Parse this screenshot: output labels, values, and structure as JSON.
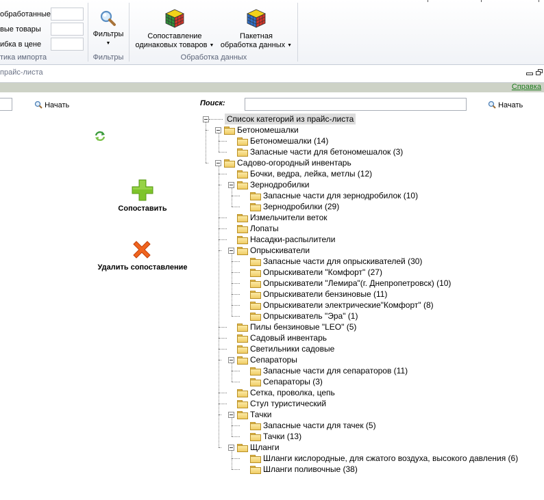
{
  "ribbon": {
    "import_group": {
      "rows": [
        "обработанные",
        "вые товары",
        "ибка в цене"
      ],
      "group_label": "тика импорта"
    },
    "filters_group": {
      "button_label": "Фильтры",
      "group_label": "Фильтры"
    },
    "processing_group": {
      "match_button": [
        "Сопоставление",
        "одинаковых товаров"
      ],
      "batch_button": [
        "Пакетная",
        "обработка данных"
      ],
      "group_label": "Обработка данных"
    }
  },
  "caption": {
    "title": "прайс-листа",
    "help_link": "Справка"
  },
  "left_search": {
    "start_label": "Начать"
  },
  "right_search": {
    "label": "Поиск:",
    "start_label": "Начать"
  },
  "actions": {
    "match_label": "Сопоставить",
    "delete_label": "Удалить сопоставление"
  },
  "colors": {
    "plus": "#7ec42a",
    "cross": "#f0641e",
    "help": "#1a7a1a",
    "green_bar": "#cdd2c6"
  },
  "tree": {
    "root": "Список категорий из прайс-листа",
    "nodes": [
      {
        "level": 1,
        "label": "Бетономешалки",
        "expanded": true,
        "last": false
      },
      {
        "level": 2,
        "label": "Бетономешалки (14)",
        "expanded": false,
        "last": false
      },
      {
        "level": 2,
        "label": "Запасные части для бетономешалок (3)",
        "expanded": false,
        "last": true
      },
      {
        "level": 1,
        "label": "Садово-огородный инвентарь",
        "expanded": true,
        "last": true
      },
      {
        "level": 2,
        "label": "Бочки, ведра, лейка, метлы (12)",
        "expanded": false,
        "last": false
      },
      {
        "level": 2,
        "label": "Зернодробилки",
        "expanded": true,
        "last": false
      },
      {
        "level": 3,
        "label": "Запасные части для зернодробилок (10)",
        "expanded": false,
        "last": false
      },
      {
        "level": 3,
        "label": "Зернодробилки (29)",
        "expanded": false,
        "last": true
      },
      {
        "level": 2,
        "label": "Измельчители веток",
        "expanded": false,
        "last": false
      },
      {
        "level": 2,
        "label": "Лопаты",
        "expanded": false,
        "last": false
      },
      {
        "level": 2,
        "label": "Насадки-распылители",
        "expanded": false,
        "last": false
      },
      {
        "level": 2,
        "label": "Опрыскиватели",
        "expanded": true,
        "last": false
      },
      {
        "level": 3,
        "label": "Запасные части для опрыскивателей (30)",
        "expanded": false,
        "last": false
      },
      {
        "level": 3,
        "label": "Опрыскиватели \"Комфорт\" (27)",
        "expanded": false,
        "last": false
      },
      {
        "level": 3,
        "label": "Опрыскиватели \"Лемира\"(г. Днепропетровск) (10)",
        "expanded": false,
        "last": false
      },
      {
        "level": 3,
        "label": "Опрыскиватели бензиновые (11)",
        "expanded": false,
        "last": false
      },
      {
        "level": 3,
        "label": "Опрыскиватели электрические\"Комфорт\" (8)",
        "expanded": false,
        "last": false
      },
      {
        "level": 3,
        "label": "Опрыскиватель \"Эра\" (1)",
        "expanded": false,
        "last": true
      },
      {
        "level": 2,
        "label": "Пилы бензиновые \"LEO\" (5)",
        "expanded": false,
        "last": false
      },
      {
        "level": 2,
        "label": "Садовый инвентарь",
        "expanded": false,
        "last": false
      },
      {
        "level": 2,
        "label": "Светильники садовые",
        "expanded": false,
        "last": false
      },
      {
        "level": 2,
        "label": "Сепараторы",
        "expanded": true,
        "last": false
      },
      {
        "level": 3,
        "label": "Запасные части для сепараторов (11)",
        "expanded": false,
        "last": false
      },
      {
        "level": 3,
        "label": "Сепараторы (3)",
        "expanded": false,
        "last": true
      },
      {
        "level": 2,
        "label": "Сетка, проволка, цепь",
        "expanded": false,
        "last": false
      },
      {
        "level": 2,
        "label": "Стул туристический",
        "expanded": false,
        "last": false
      },
      {
        "level": 2,
        "label": "Тачки",
        "expanded": true,
        "last": false
      },
      {
        "level": 3,
        "label": "Запасные части для тачек (5)",
        "expanded": false,
        "last": false
      },
      {
        "level": 3,
        "label": "Тачки (13)",
        "expanded": false,
        "last": true
      },
      {
        "level": 2,
        "label": "Щланги",
        "expanded": true,
        "last": true
      },
      {
        "level": 3,
        "label": "Шланги кислородные, для сжатого воздуха, высокого давления (6)",
        "expanded": false,
        "last": false
      },
      {
        "level": 3,
        "label": "Шланги поливочные (38)",
        "expanded": false,
        "last": true
      }
    ]
  }
}
